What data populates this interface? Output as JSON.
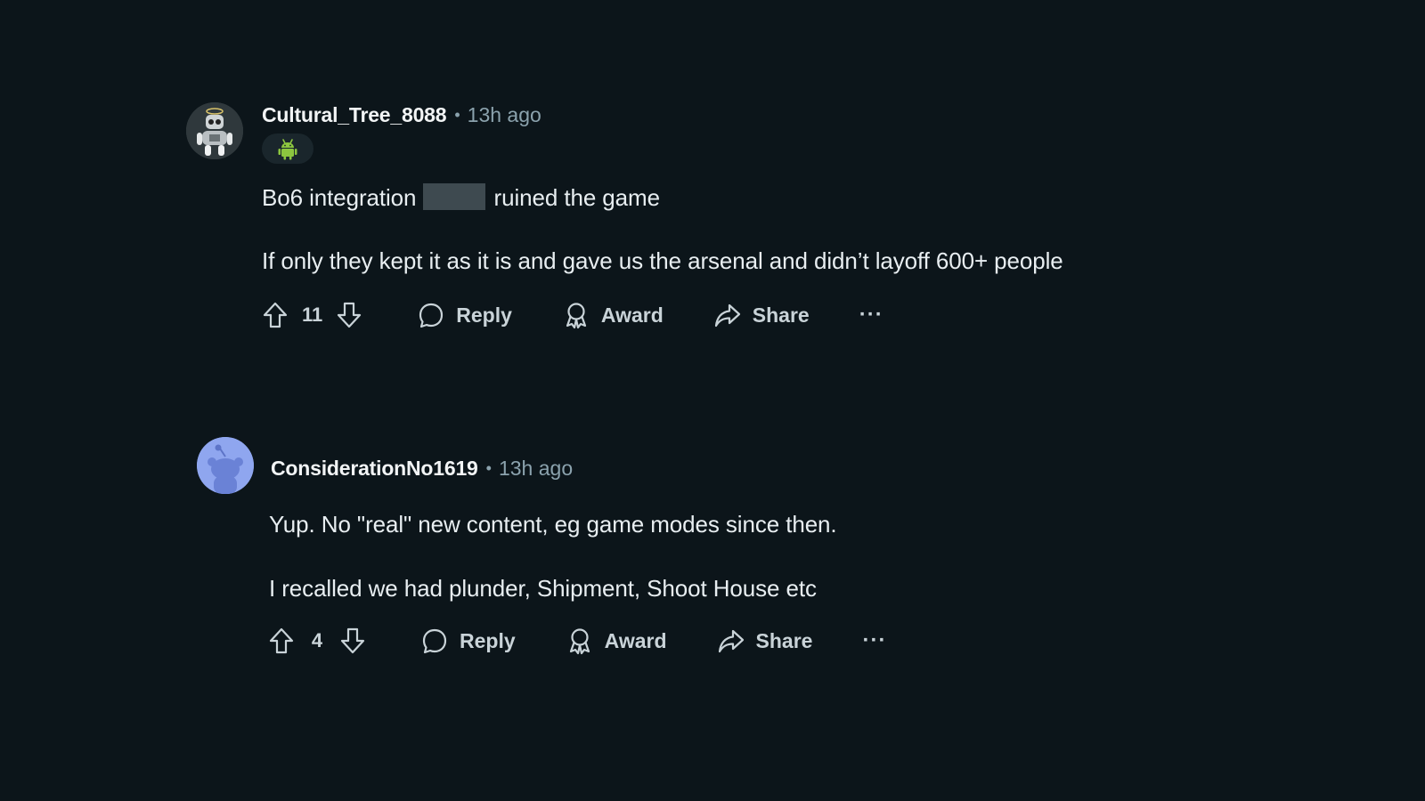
{
  "comments": [
    {
      "username": "Cultural_Tree_8088",
      "separator": "•",
      "time": "13h ago",
      "flair_icon": "android-icon",
      "lines": [
        {
          "before": "Bo6 integration",
          "after": "ruined the game"
        },
        {
          "text": "If only they kept it as it is and gave us the arsenal and didn’t layoff 600+ people"
        }
      ],
      "votes": "11",
      "reply_label": "Reply",
      "award_label": "Award",
      "share_label": "Share",
      "more_label": "···"
    },
    {
      "username": "ConsiderationNo1619",
      "separator": "•",
      "time": "13h ago",
      "lines": [
        {
          "text": "Yup. No \"real\" new content, eg game modes since then."
        },
        {
          "text": "I recalled we had plunder, Shipment, Shoot House etc"
        }
      ],
      "votes": "4",
      "reply_label": "Reply",
      "award_label": "Award",
      "share_label": "Share",
      "more_label": "···"
    }
  ],
  "colors": {
    "background": "#0c151a",
    "text": "#e8eef1",
    "muted": "#8ba2ad",
    "snoo_avatar_bg": "#8fa6ef",
    "android_green": "#8cc63f"
  }
}
